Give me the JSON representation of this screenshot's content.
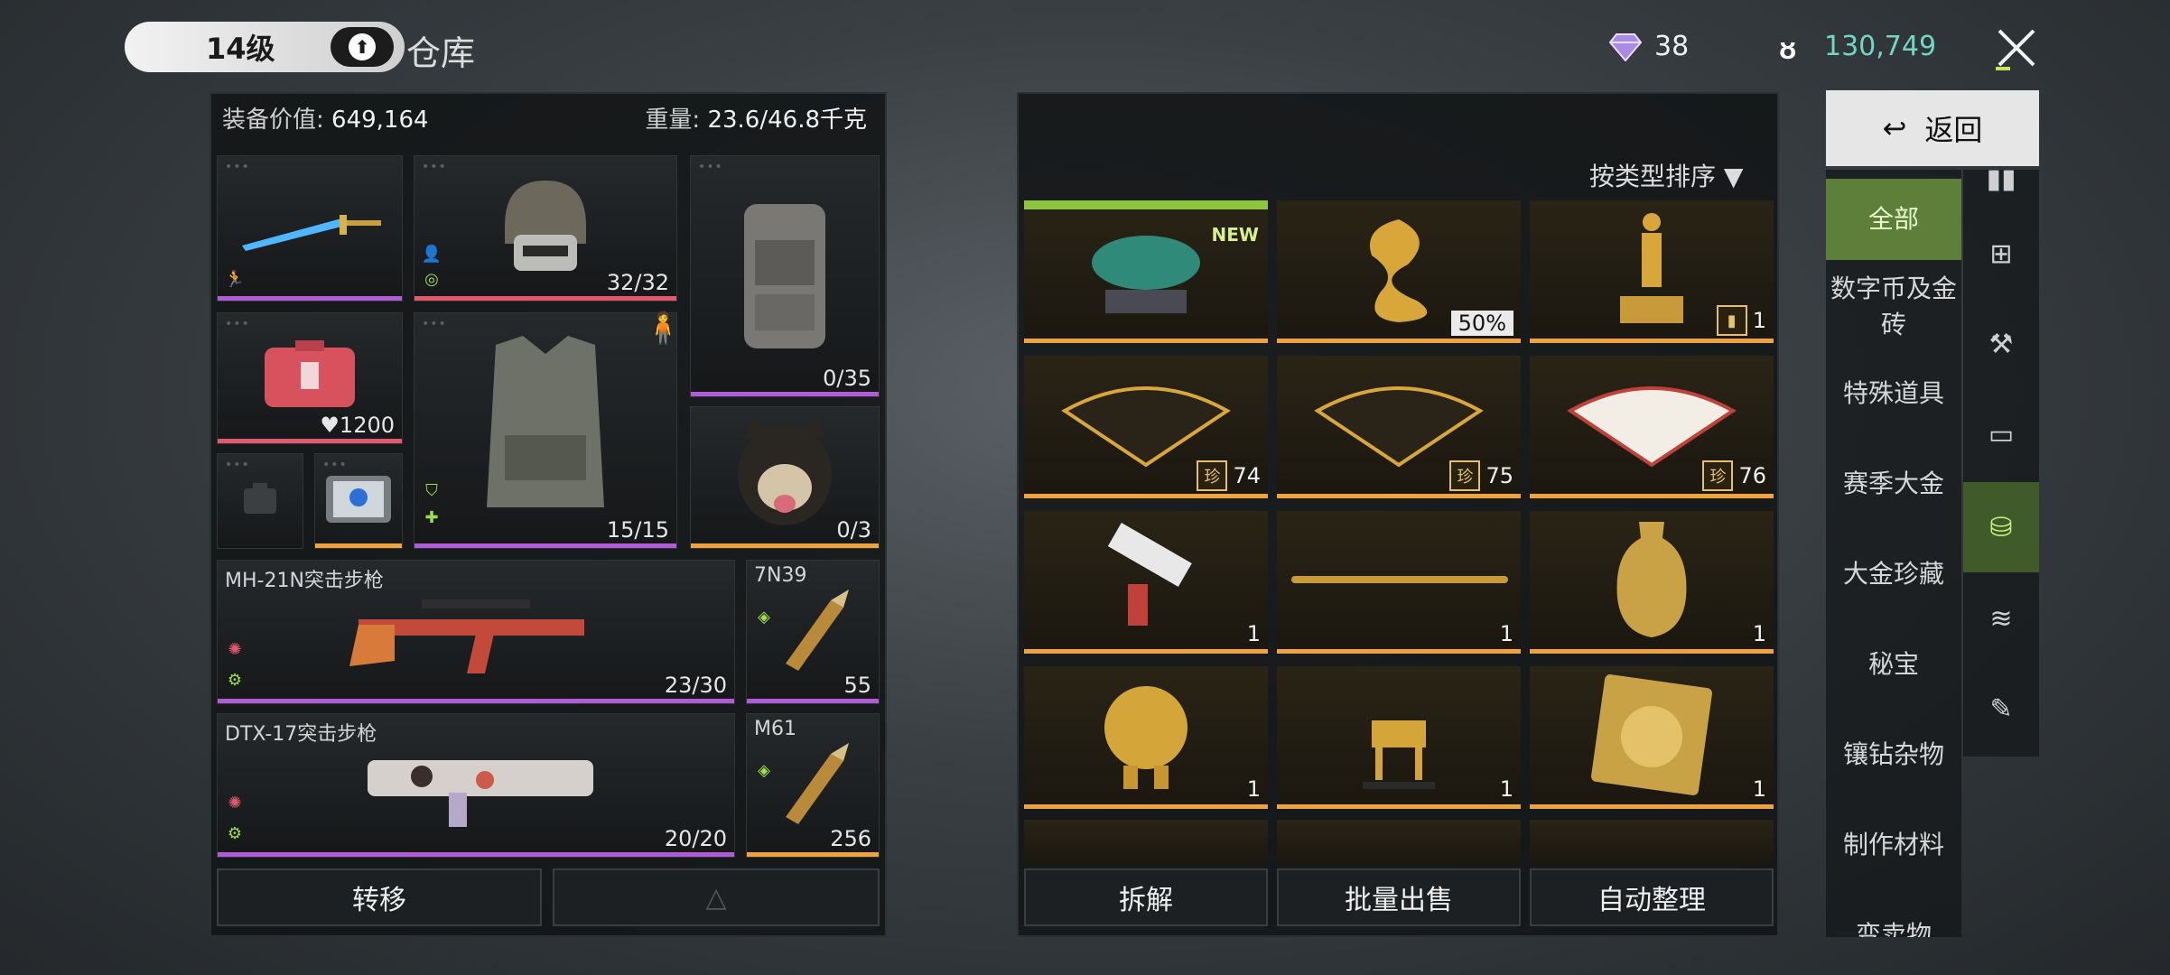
{
  "header": {
    "level": "14级",
    "title": "仓库",
    "gems": "38",
    "coins": "130,749"
  },
  "loadout": {
    "value_label": "装备价值:",
    "value": "649,164",
    "weight_label": "重量:",
    "weight": "23.6/46.8千克",
    "helmet_count": "32/32",
    "backpack_count": "0/35",
    "armor_count": "15/15",
    "pet_count": "0/3",
    "case_count": "1200",
    "weapon1_name": "MH-21N突击步枪",
    "weapon1_ammo": "23/30",
    "ammo1_name": "7N39",
    "ammo1_count": "55",
    "weapon2_name": "DTX-17突击步枪",
    "weapon2_ammo": "20/20",
    "ammo2_name": "M61",
    "ammo2_count": "256",
    "transfer_label": "转移"
  },
  "storage": {
    "sort_label": "按类型排序",
    "new_badge": "NEW",
    "items": [
      {
        "name": "bull-statue",
        "qty": ""
      },
      {
        "name": "golden-dragon",
        "qty": "50%"
      },
      {
        "name": "golden-figure",
        "qty": "1"
      },
      {
        "name": "fan-1",
        "qty": "74"
      },
      {
        "name": "fan-2",
        "qty": "75"
      },
      {
        "name": "fan-3",
        "qty": "76"
      },
      {
        "name": "gun-item",
        "qty": "1"
      },
      {
        "name": "golden-sword",
        "qty": "1"
      },
      {
        "name": "golden-vase",
        "qty": "1"
      },
      {
        "name": "golden-robot",
        "qty": "1"
      },
      {
        "name": "golden-deer",
        "qty": "1"
      },
      {
        "name": "golden-disc",
        "qty": "1"
      }
    ],
    "disassemble_label": "拆解",
    "bulk_sell_label": "批量出售",
    "auto_sort_label": "自动整理"
  },
  "sidebar": {
    "back_label": "返回",
    "categories": [
      "全部",
      "数字币及金砖",
      "特殊道具",
      "赛季大金",
      "大金珍藏",
      "秘宝",
      "镶钻杂物",
      "制作材料",
      "变卖物"
    ]
  },
  "colors": {
    "accent_green": "#8cc63f",
    "coin": "#6fd7c4",
    "rarity_gold": "#f0a33a",
    "rarity_purple": "#b25bd8",
    "rarity_red": "#e0596c"
  }
}
